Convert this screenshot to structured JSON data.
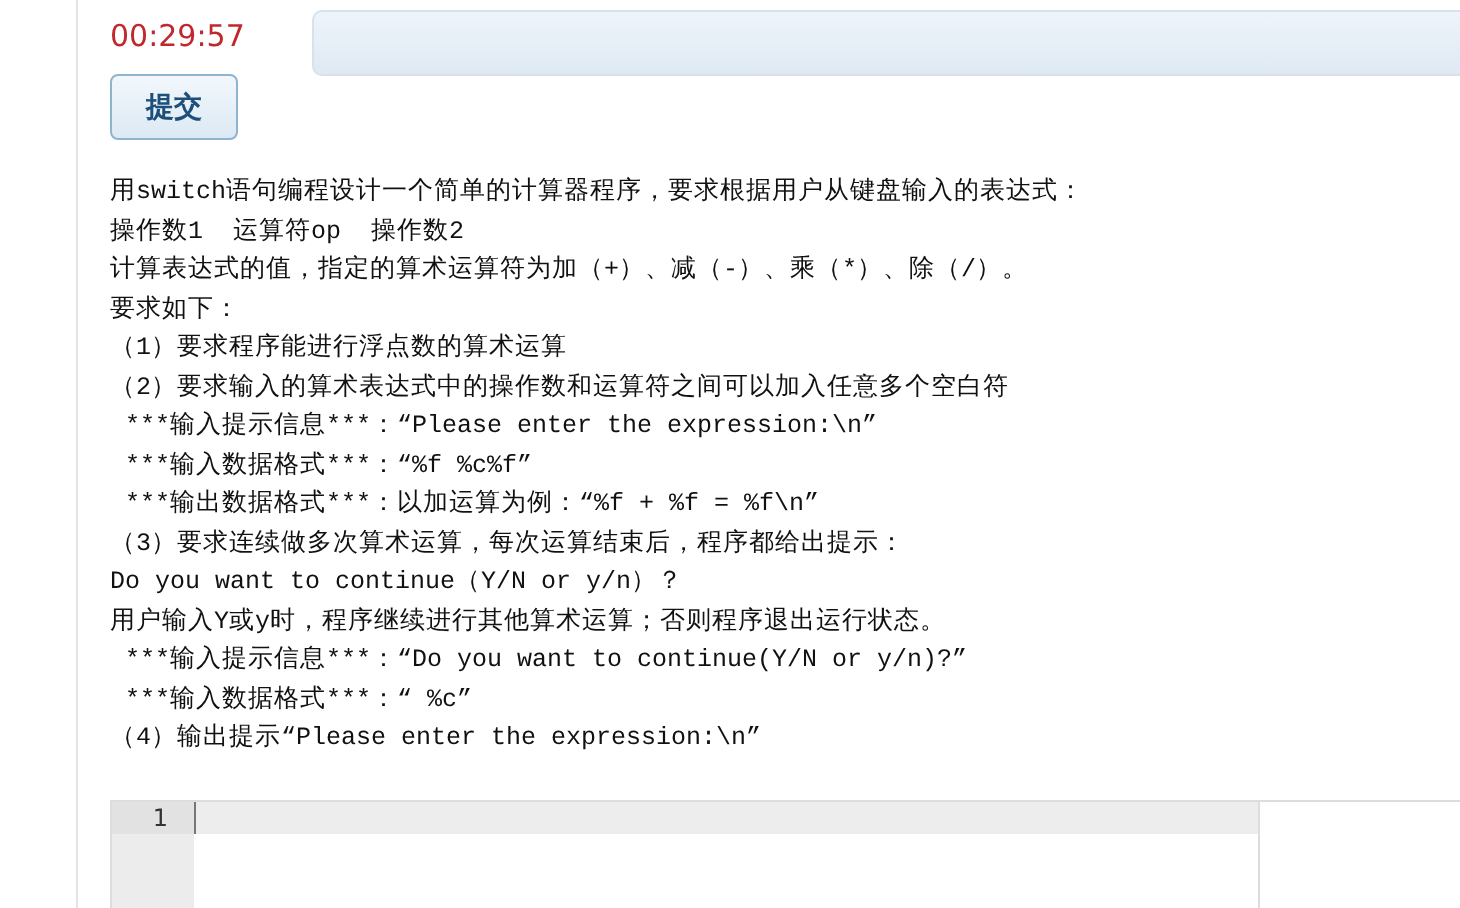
{
  "timer": "00:29:57",
  "submit_button": "提交",
  "description": [
    "用switch语句编程设计一个简单的计算器程序，要求根据用户从键盘输入的表达式：",
    "操作数1  运算符op  操作数2",
    "计算表达式的值，指定的算术运算符为加（+）、减（-）、乘（*）、除（/）。",
    "要求如下：",
    "（1）要求程序能进行浮点数的算术运算",
    "（2）要求输入的算术表达式中的操作数和运算符之间可以加入任意多个空白符",
    " ***输入提示信息***：“Please enter the expression:\\n”",
    " ***输入数据格式***：“%f %c%f”",
    " ***输出数据格式***：以加运算为例：“%f + %f = %f\\n”",
    "（3）要求连续做多次算术运算，每次运算结束后，程序都给出提示：",
    "Do you want to continue（Y/N or y/n）？",
    "用户输入Y或y时，程序继续进行其他算术运算；否则程序退出运行状态。",
    " ***输入提示信息***：“Do you want to continue(Y/N or y/n)?”",
    " ***输入数据格式***：“ %c”",
    "（4）输出提示“Please enter the expression:\\n”"
  ],
  "editor": {
    "line_numbers": [
      "1"
    ]
  }
}
